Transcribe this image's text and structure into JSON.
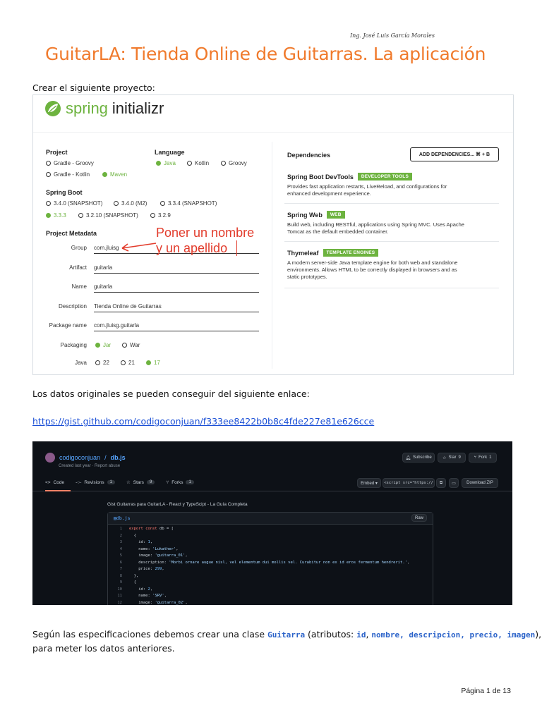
{
  "author": "Ing. José Luis García Morales",
  "title": "GuitarLA: Tienda Online de Guitarras. La aplicación",
  "intro": "Crear el siguiente proyecto:",
  "spring": {
    "brand": "spring",
    "product": "initializr",
    "project": {
      "label": "Project",
      "options": [
        {
          "label": "Gradle - Groovy",
          "selected": false
        },
        {
          "label": "Gradle - Kotlin",
          "selected": false
        },
        {
          "label": "Maven",
          "selected": true
        }
      ]
    },
    "language": {
      "label": "Language",
      "options": [
        {
          "label": "Java",
          "selected": true
        },
        {
          "label": "Kotlin",
          "selected": false
        },
        {
          "label": "Groovy",
          "selected": false
        }
      ]
    },
    "boot": {
      "label": "Spring Boot",
      "options": [
        {
          "label": "3.4.0 (SNAPSHOT)",
          "selected": false
        },
        {
          "label": "3.4.0 (M2)",
          "selected": false
        },
        {
          "label": "3.3.4 (SNAPSHOT)",
          "selected": false
        },
        {
          "label": "3.3.3",
          "selected": true
        },
        {
          "label": "3.2.10 (SNAPSHOT)",
          "selected": false
        },
        {
          "label": "3.2.9",
          "selected": false
        }
      ]
    },
    "metadata": {
      "label": "Project Metadata",
      "fields": [
        {
          "label": "Group",
          "value": "com.jluisg"
        },
        {
          "label": "Artifact",
          "value": "guitarla"
        },
        {
          "label": "Name",
          "value": "guitarla"
        },
        {
          "label": "Description",
          "value": "Tienda Online de Guitarras"
        },
        {
          "label": "Package name",
          "value": "com.jluisg.guitarla"
        }
      ],
      "packaging": {
        "label": "Packaging",
        "options": [
          {
            "label": "Jar",
            "selected": true
          },
          {
            "label": "War",
            "selected": false
          }
        ]
      },
      "java": {
        "label": "Java",
        "options": [
          {
            "label": "22",
            "selected": false
          },
          {
            "label": "21",
            "selected": false
          },
          {
            "label": "17",
            "selected": true
          }
        ]
      }
    },
    "annotation_line1": "Poner un nombre",
    "annotation_line2": "y un apellido",
    "dependencies": {
      "label": "Dependencies",
      "add_button": "ADD DEPENDENCIES...  ⌘ + B",
      "items": [
        {
          "name": "Spring Boot DevTools",
          "tag": "DEVELOPER TOOLS",
          "desc": "Provides fast application restarts, LiveReload, and configurations for enhanced development experience."
        },
        {
          "name": "Spring Web",
          "tag": "WEB",
          "desc": "Build web, including RESTful, applications using Spring MVC. Uses Apache Tomcat as the default embedded container."
        },
        {
          "name": "Thymeleaf",
          "tag": "TEMPLATE ENGINES",
          "desc": "A modern server-side Java template engine for both web and standalone environments. Allows HTML to be correctly displayed in browsers and as static prototypes."
        }
      ]
    }
  },
  "source_text": "Los datos originales se pueden conseguir del siguiente enlace:",
  "link": "https://gist.github.com/codigoconjuan/f333ee8422b0b8c4fde227e81e626cce",
  "gist": {
    "user": "codigoconjuan",
    "file_title": "db.js",
    "created": "Created last year · Report abuse",
    "subscribe": "Subscribe",
    "star": "Star",
    "star_count": "9",
    "fork": "Fork",
    "fork_count": "1",
    "tabs": [
      {
        "label": "Code",
        "count": ""
      },
      {
        "label": "Revisions",
        "count": "1"
      },
      {
        "label": "Stars",
        "count": "9"
      },
      {
        "label": "Forks",
        "count": "1"
      }
    ],
    "embed": "Embed ▾",
    "embed_code": "<script src=\"https://",
    "download": "Download ZIP",
    "description": "Gist Guitarras para GuitarLA - React y TypeScipt - La Guía Completa",
    "filename": "db.js",
    "raw": "Raw",
    "lines": [
      "export const db = [",
      "  {",
      "    id: 1,",
      "    name: 'Lukather',",
      "    image: 'guitarra_01',",
      "    description: 'Morbi ornare augue nisl, vel elementum dui mollis vel. Curabitur non ex id eros fermentum hendrerit.',",
      "    price: 299,",
      "  },",
      "  {",
      "    id: 2,",
      "    name: 'SRV',",
      "    image: 'guitarra_02',"
    ]
  },
  "spec": {
    "p1": "Según las especificaciones debemos crear una clase ",
    "class_name": "Guitarra",
    "p2": " (atributos: ",
    "a1": "id",
    "sep": ", ",
    "a2": "nombre, descripcion, precio, imagen",
    "p3": "),",
    "line2": "para meter los datos anteriores."
  },
  "footer": "Página 1 de 13",
  "colors": {
    "title": "#f07a2c",
    "spring_green": "#6db33f",
    "link": "#1a4fd6",
    "annotation": "#e23b2b"
  }
}
